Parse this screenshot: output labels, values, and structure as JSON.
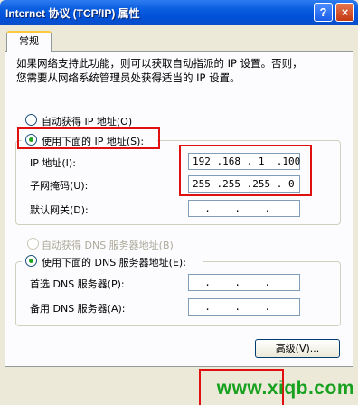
{
  "window": {
    "title": "Internet 协议 (TCP/IP) 属性",
    "help_label": "?",
    "close_label": "×"
  },
  "tab": {
    "label": "常规"
  },
  "description": {
    "line1": "如果网络支持此功能，则可以获取自动指派的 IP 设置。否则，",
    "line2": "您需要从网络系统管理员处获得适当的 IP 设置。"
  },
  "ip_section": {
    "auto_label": "自动获得 IP 地址(O)",
    "manual_label": "使用下面的 IP 地址(S):",
    "ip_label": "IP 地址(I):",
    "ip_value": "192 .168 . 1  .100",
    "mask_label": "子网掩码(U):",
    "mask_value": "255 .255 .255 . 0",
    "gateway_label": "默认网关(D):",
    "gateway_value": "  .    .    .   "
  },
  "dns_section": {
    "auto_label": "自动获得 DNS 服务器地址(B)",
    "manual_label": "使用下面的 DNS 服务器地址(E):",
    "preferred_label": "首选 DNS 服务器(P):",
    "preferred_value": "  .    .    .   ",
    "alternate_label": "备用 DNS 服务器(A):",
    "alternate_value": "  .    .    .   "
  },
  "advanced_button": "高级(V)...",
  "watermark": "www.xiqb.com",
  "colors": {
    "titlebar": "#0054e3",
    "highlight": "#e01010",
    "watermark": "#17a11f",
    "dialog_bg": "#ece9d8"
  }
}
